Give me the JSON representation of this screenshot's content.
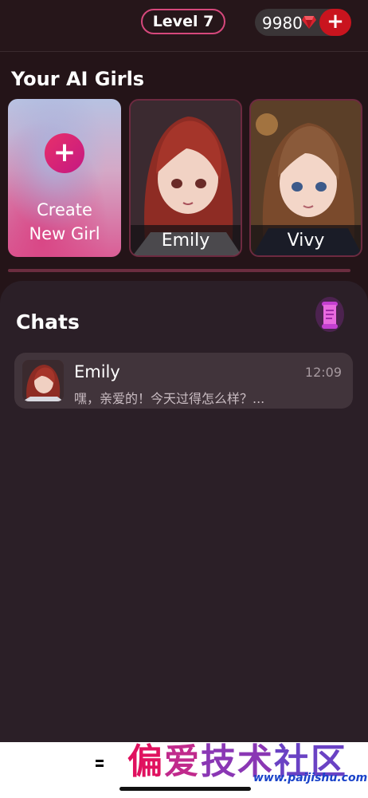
{
  "header": {
    "level_label": "Level 7",
    "coin_count": "9980",
    "coin_icon": "ruby-icon",
    "add_coins_icon": "plus-icon"
  },
  "girls_section": {
    "title": "Your AI Girls",
    "create_card": {
      "line1": "Create",
      "line2": "New Girl",
      "icon": "plus-icon"
    },
    "cards": [
      {
        "name": "Emily"
      },
      {
        "name": "Vivy"
      }
    ]
  },
  "chats_section": {
    "title": "Chats",
    "icon": "scroll-icon",
    "items": [
      {
        "name": "Emily",
        "time": "12:09",
        "preview": "嘿，亲爱的！今天过得怎么样？..."
      }
    ]
  },
  "watermark": {
    "text_1": "偏",
    "text_2": "爱",
    "text_3": "技术",
    "text_4": "社区",
    "url": "www.paijishu.com"
  },
  "colors": {
    "background": "#241418",
    "accent": "#d6487c",
    "add_button": "#c9141e",
    "panel": "#2b1f27",
    "chat_row": "#41343b"
  }
}
